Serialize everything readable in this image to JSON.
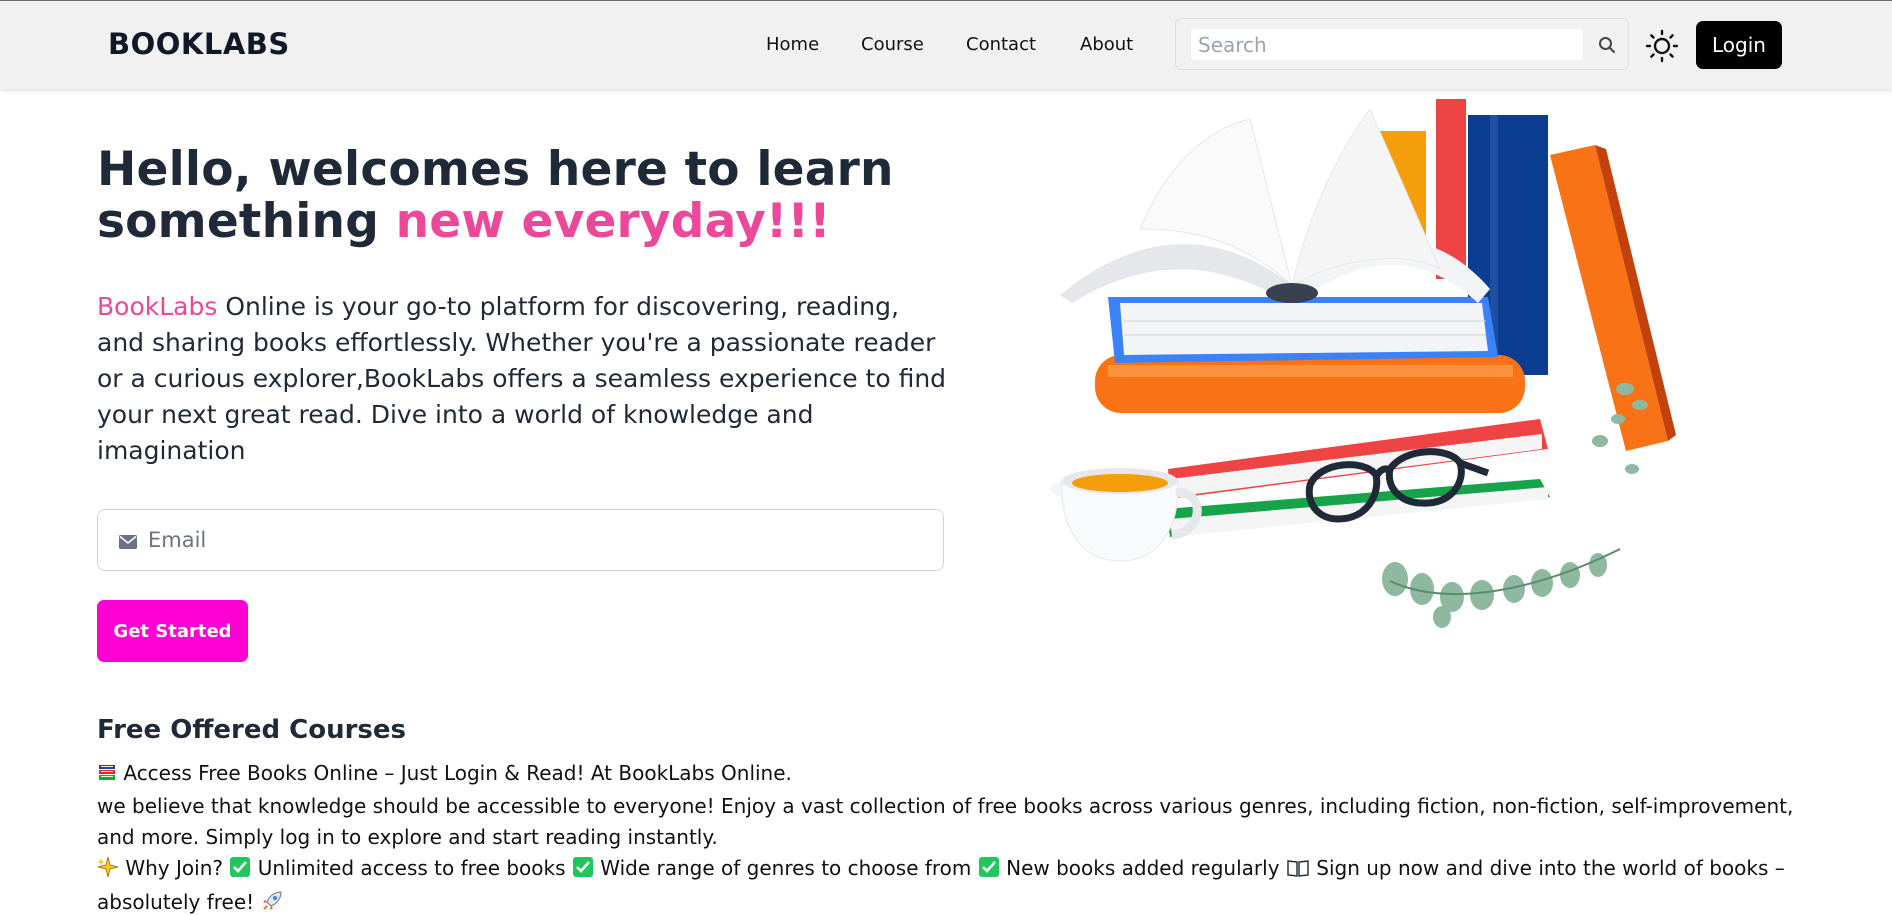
{
  "navbar": {
    "brand": "BOOKLABS",
    "links": [
      "Home",
      "Course",
      "Contact",
      "About"
    ],
    "search_placeholder": "Search",
    "login_label": "Login"
  },
  "hero": {
    "title_part1": "Hello, welcomes here to learn something ",
    "title_highlight": "new everyday!!!",
    "desc_highlight": "BookLabs",
    "desc_rest": " Online is your go-to platform for discovering, reading, and sharing books effortlessly. Whether you're a passionate reader or a curious explorer,BookLabs offers a seamless experience to find your next great read. Dive into a world of knowledge and imagination",
    "email_placeholder": "Email",
    "cta_label": "Get Started"
  },
  "courses": {
    "title": "Free Offered Courses",
    "line1": "Access Free Books Online – Just Login & Read! At BookLabs Online.",
    "line2": "we believe that knowledge should be accessible to everyone! Enjoy a vast collection of free books across various genres, including fiction, non-fiction, self-improvement, and more. Simply log in to explore and start reading instantly.",
    "why_join": "Why Join?",
    "benefit1": "Unlimited access to free books",
    "benefit2": "Wide range of genres to choose from",
    "benefit3": "New books added regularly",
    "signup_text": "Sign up now and dive into the world of books – absolutely free!"
  },
  "colors": {
    "accent_pink": "#ec4899",
    "cta_magenta": "#ff00d4",
    "navbar_bg": "#f1f1f1",
    "text_dark": "#1f2937"
  },
  "icons": {
    "search": "search-icon",
    "theme": "sun-icon",
    "email": "envelope-icon",
    "books": "books-emoji",
    "sparkle": "sparkle-emoji",
    "check": "check-emoji",
    "open_book": "open-book-emoji",
    "rocket": "rocket-emoji"
  }
}
